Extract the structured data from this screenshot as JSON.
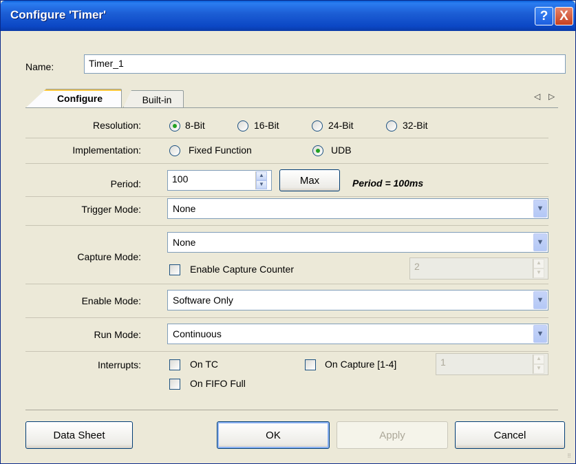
{
  "window": {
    "title": "Configure 'Timer'",
    "help_icon": "?",
    "close_icon": "X"
  },
  "name": {
    "label": "Name:",
    "value": "Timer_1"
  },
  "tabs": [
    {
      "label": "Configure",
      "active": true
    },
    {
      "label": "Built-in",
      "active": false
    }
  ],
  "tab_scroll": {
    "left": "◁",
    "right": "▷"
  },
  "resolution": {
    "label": "Resolution:",
    "options": [
      {
        "label": "8-Bit",
        "checked": true
      },
      {
        "label": "16-Bit",
        "checked": false
      },
      {
        "label": "24-Bit",
        "checked": false
      },
      {
        "label": "32-Bit",
        "checked": false
      }
    ]
  },
  "implementation": {
    "label": "Implementation:",
    "options": [
      {
        "label": "Fixed Function",
        "checked": false
      },
      {
        "label": "UDB",
        "checked": true
      }
    ]
  },
  "period": {
    "label": "Period:",
    "value": "100",
    "max_button": "Max",
    "note": "Period = 100ms"
  },
  "trigger_mode": {
    "label": "Trigger Mode:",
    "value": "None"
  },
  "capture_mode": {
    "label": "Capture Mode:",
    "value": "None",
    "enable_counter_label": "Enable Capture Counter",
    "enable_counter_checked": false,
    "counter_value": "2"
  },
  "enable_mode": {
    "label": "Enable Mode:",
    "value": "Software Only"
  },
  "run_mode": {
    "label": "Run Mode:",
    "value": "Continuous"
  },
  "interrupts": {
    "label": "Interrupts:",
    "on_tc": "On TC",
    "on_capture": "On Capture [1-4]",
    "on_fifo_full": "On FIFO Full",
    "capture_count": "1"
  },
  "buttons": {
    "datasheet": "Data Sheet",
    "ok": "OK",
    "apply": "Apply",
    "cancel": "Cancel"
  }
}
